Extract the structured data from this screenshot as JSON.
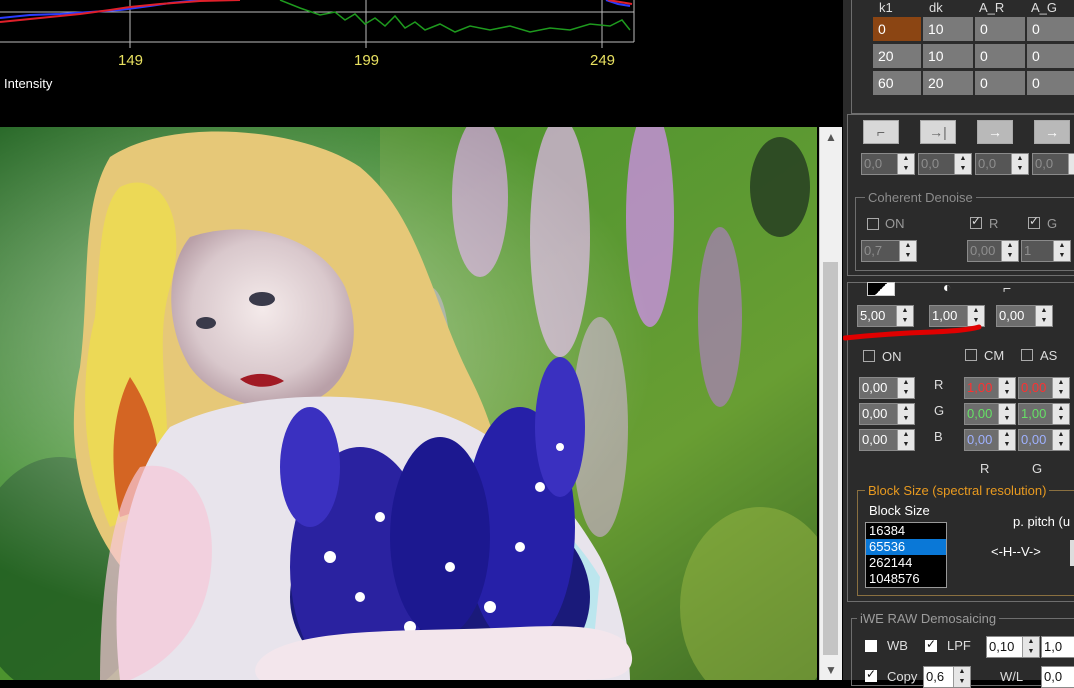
{
  "histogram": {
    "ticks": [
      "149",
      "199",
      "249"
    ],
    "axis_label": "Intensity"
  },
  "table": {
    "headers": [
      "k1",
      "dk",
      "A_R",
      "A_G"
    ],
    "rows": [
      [
        "0",
        "10",
        "0",
        "0"
      ],
      [
        "20",
        "10",
        "0",
        "0"
      ],
      [
        "60",
        "20",
        "0",
        "0"
      ]
    ]
  },
  "curve_spins": [
    "0,0",
    "0,0",
    "0,0",
    "0,0"
  ],
  "coherent_denoise": {
    "title": "Coherent Denoise",
    "on_label": "ON",
    "r_label": "R",
    "g_label": "G",
    "spin1": "0,7",
    "spin2": "0,00",
    "spin3": "1"
  },
  "levels": {
    "spin_a": "5,00",
    "spin_b": "1,00",
    "spin_c": "0,00"
  },
  "color_matrix": {
    "on_label": "ON",
    "cm_label": "CM",
    "as_label": "AS",
    "row_labels": [
      "R",
      "G",
      "B"
    ],
    "col_labels": [
      "R",
      "G"
    ],
    "left_spins": [
      "0,00",
      "0,00",
      "0,00"
    ],
    "matrix": [
      [
        "1,00",
        "0,00"
      ],
      [
        "0,00",
        "1,00"
      ],
      [
        "0,00",
        "0,00"
      ]
    ]
  },
  "block_size": {
    "title": "Block Size (spectral resolution)",
    "label": "Block Size",
    "options": [
      "16384",
      "65536",
      "262144",
      "1048576"
    ],
    "selected": "65536",
    "pitch_label": "p. pitch (u",
    "hv_label": "<-H--V->"
  },
  "demosaic": {
    "title": "iWE RAW Demosaicing",
    "wb_label": "WB",
    "lpf_label": "LPF",
    "lpf_value": "0,10",
    "lpf_value2": "1,0",
    "copy_label": "Copy",
    "copy_value": "0,6",
    "wl_label": "W/L",
    "wl_value": "0,0"
  },
  "colors": {
    "panel_bg": "#2b2b2b",
    "selected_cell": "#8b4513",
    "highlight": "#0a78d7",
    "annotation_red": "#e00000"
  }
}
